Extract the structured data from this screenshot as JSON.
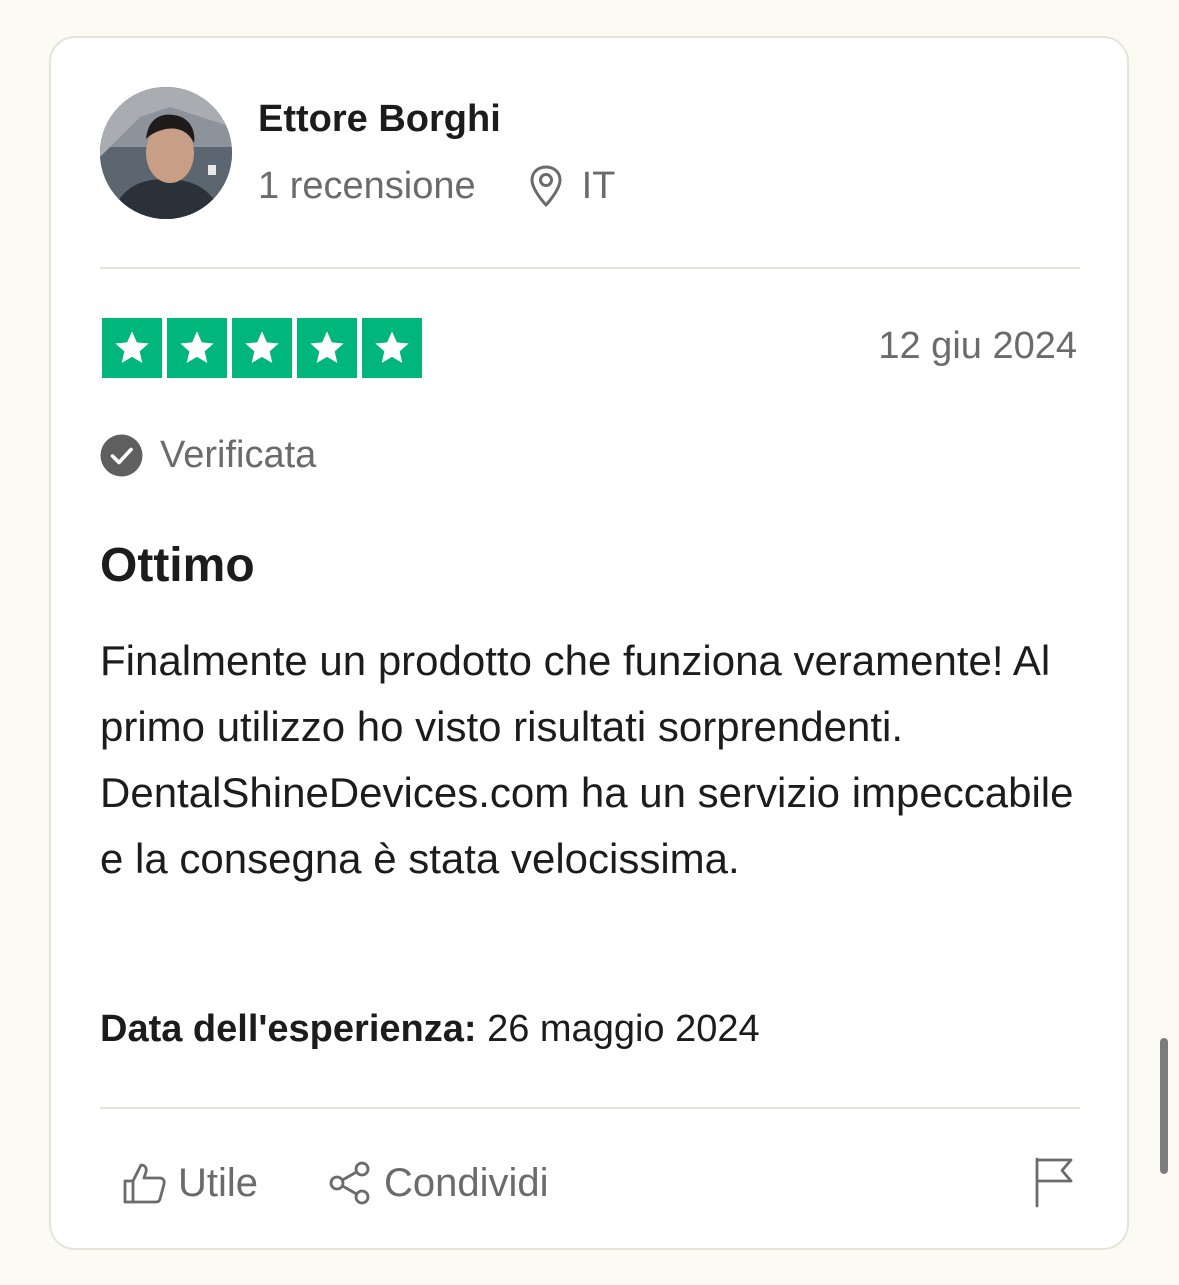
{
  "reviewer": {
    "name": "Ettore Borghi",
    "review_count": "1 recensione",
    "country": "IT",
    "avatar_icon": "user-photo"
  },
  "rating": {
    "stars": 5,
    "max": 5,
    "color": "#00b67a"
  },
  "review": {
    "date": "12 giu 2024",
    "verified_label": "Verificata",
    "title": "Ottimo",
    "body": "Finalmente un prodotto che funziona veramente! Al primo utilizzo ho visto risultati sorprendenti. DentalShineDevices.com ha un servizio impeccabile e la consegna è stata velocissima.",
    "experience_label": "Data dell'esperienza:",
    "experience_date": "26 maggio 2024"
  },
  "actions": {
    "useful_label": "Utile",
    "share_label": "Condividi",
    "flag_icon": "flag-icon"
  },
  "colors": {
    "accent": "#00b67a",
    "muted_text": "#6b6b6b",
    "page_bg": "#fbfaf3"
  }
}
